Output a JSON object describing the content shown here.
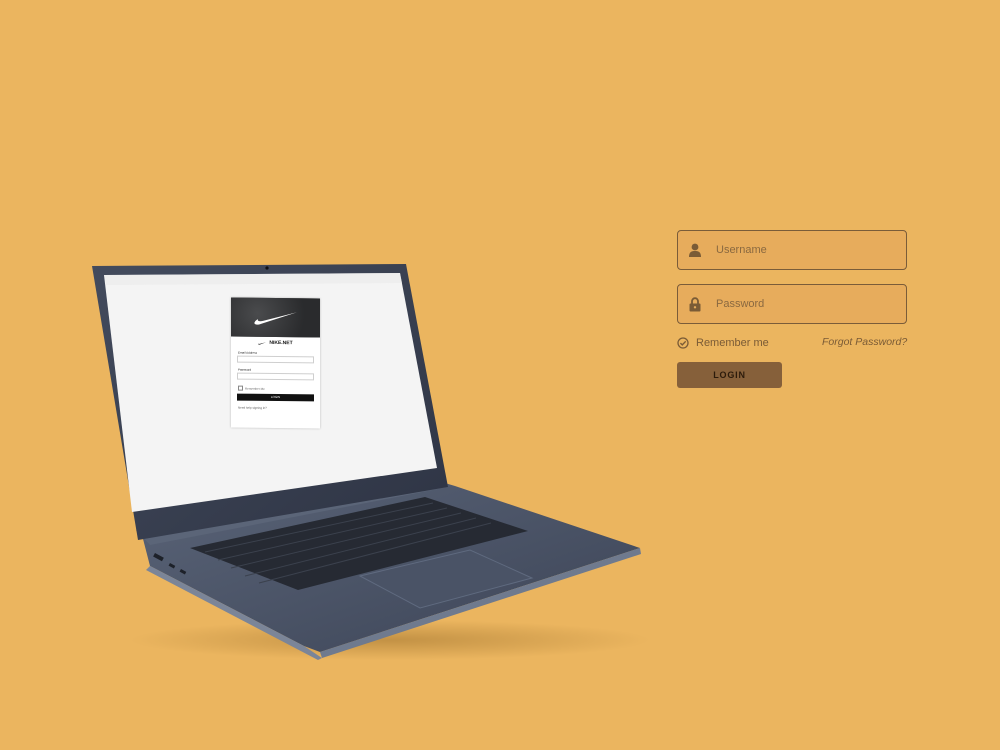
{
  "colors": {
    "background": "#ebb55f",
    "field_border": "#7a5c39",
    "text": "#7a5b36",
    "button": "#86603a"
  },
  "laptop_screen": {
    "brand": "NIKE.NET",
    "email_label": "Email Address",
    "password_label": "Password",
    "remember_label": "Remember Me",
    "login_label": "LOGIN",
    "help_text": "Need help signing in?"
  },
  "login_form": {
    "username": {
      "placeholder": "Username",
      "icon": "user-icon"
    },
    "password": {
      "placeholder": "Password",
      "icon": "lock-icon"
    },
    "remember_me": {
      "label": "Remember me",
      "checked": true,
      "icon": "check-circle-icon"
    },
    "forgot_password": "Forgot Password?",
    "login_button": "LOGIN"
  }
}
